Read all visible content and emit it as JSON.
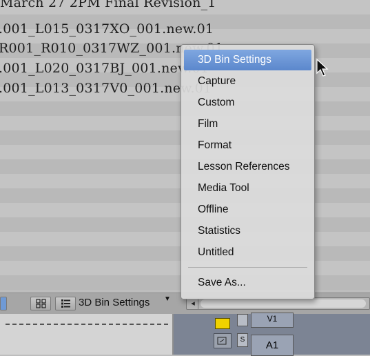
{
  "bin": {
    "rows": [
      "March 27 2PM Final Revision_1",
      ".001_L015_0317XO_001.new.01",
      "R001_R010_0317WZ_001.new.01",
      ".001_L020_0317BJ_001.new.01",
      ".001_L013_0317V0_001.new.01"
    ]
  },
  "toolbar": {
    "view_selector_label": "3D Bin Settings",
    "view_selector_arrow": "▼",
    "scroll_left_arrow": "◂"
  },
  "menu": {
    "items": [
      {
        "label": "3D Bin Settings",
        "active": true
      },
      {
        "label": "Capture"
      },
      {
        "label": "Custom"
      },
      {
        "label": "Film"
      },
      {
        "label": "Format"
      },
      {
        "label": "Lesson References"
      },
      {
        "label": "Media Tool"
      },
      {
        "label": "Offline"
      },
      {
        "label": "Statistics"
      },
      {
        "label": "Untitled"
      }
    ],
    "save_as": "Save As..."
  },
  "timeline": {
    "track_v1": "V1",
    "track_a1": "A1",
    "solo_label": "S"
  },
  "icons": {
    "frame_view": "grid-view-icon",
    "script_view": "list-view-icon",
    "cursor": "mouse-pointer-icon"
  },
  "colors": {
    "highlight": "#6a95d6",
    "yellow_button": "#f0d200"
  }
}
